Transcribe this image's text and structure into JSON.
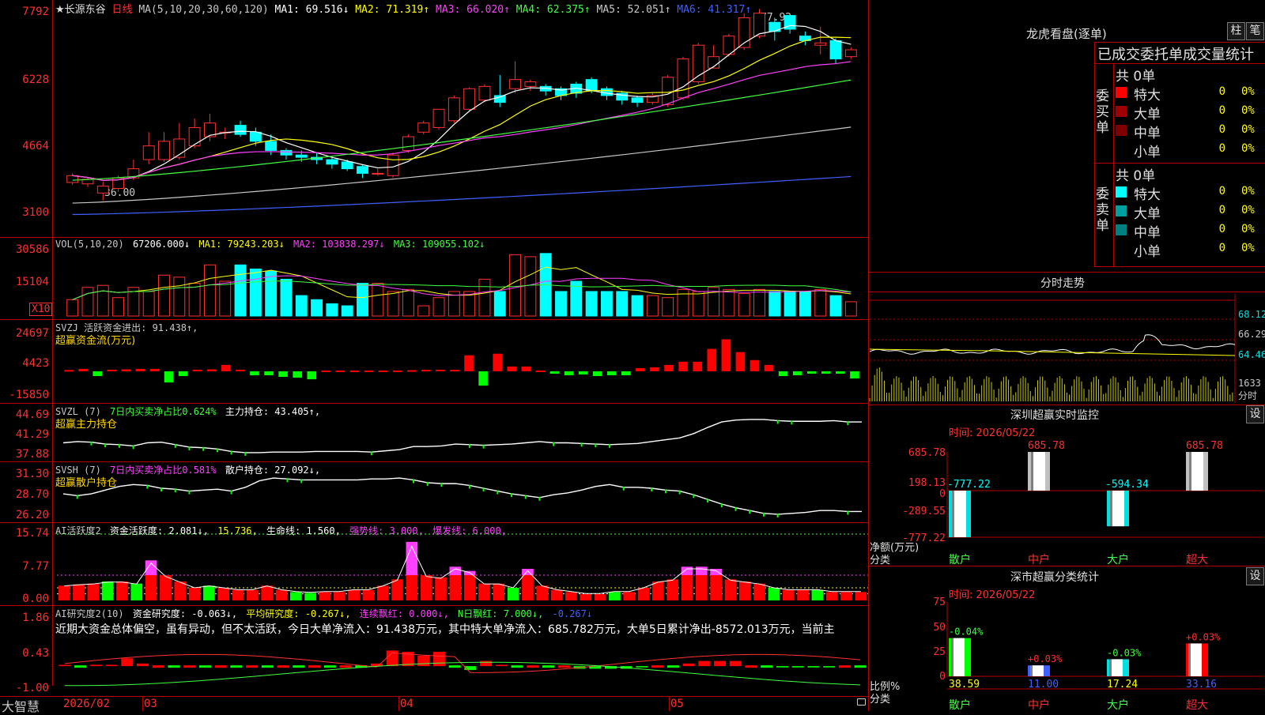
{
  "header": {
    "stock_name": "★长源东谷",
    "period": "日线",
    "ma_params": "MA(5,10,20,30,60,120)",
    "ma_items": [
      {
        "label": "MA1: 69.516↓",
        "color": "#ffffff"
      },
      {
        "label": "MA2: 71.319↑",
        "color": "#ffff00"
      },
      {
        "label": "MA3: 66.020↑",
        "color": "#ff40ff"
      },
      {
        "label": "MA4: 62.375↑",
        "color": "#40ff40"
      },
      {
        "label": "MA5: 52.051↑",
        "color": "#c8c8c8"
      },
      {
        "label": "MA6: 41.317↑",
        "color": "#4060ff"
      }
    ],
    "high_marker": "77.92",
    "low_marker": "36.00"
  },
  "panels": {
    "vol": {
      "params": "VOL(5,10,20)",
      "items": [
        {
          "label": "67206.000↓",
          "color": "#ffffff"
        },
        {
          "label": "MA1: 79243.203↓",
          "color": "#ffff00"
        },
        {
          "label": "MA2: 103838.297↓",
          "color": "#ff40ff"
        },
        {
          "label": "MA3: 109055.102↓",
          "color": "#40ff40"
        }
      ],
      "ylabels": [
        "30586",
        "15104"
      ],
      "unit": "X10"
    },
    "svzj": {
      "title": "SVZJ  活跃资金进出: 91.438↑,",
      "sub": "超赢资金流(万元)",
      "ylabels": [
        "24697",
        "4423",
        "-15850"
      ]
    },
    "svzl": {
      "title_a": "SVZL (7)",
      "title_b": "7日内买卖净占比0.624%",
      "title_c": "主力持仓: 43.405↑,",
      "sub": "超赢主力持仓",
      "ylabels": [
        "44.69",
        "41.29",
        "37.88"
      ]
    },
    "svsh": {
      "title_a": "SVSH (7)",
      "title_b": "7日内买卖净占比0.581%",
      "title_c": "散户持仓: 27.092↓,",
      "sub": "超赢散户持仓",
      "ylabels": [
        "31.30",
        "28.70",
        "26.20"
      ]
    },
    "ai1": {
      "items": [
        {
          "label": "AI活跃度2",
          "color": "#c8c8c8"
        },
        {
          "label": "资金活跃度: 2.081↓,",
          "color": "#ffffff"
        },
        {
          "label": "15.736,",
          "color": "#ffff00"
        },
        {
          "label": "生命线: 1.560,",
          "color": "#ffffff"
        },
        {
          "label": "强势线: 3.000,",
          "color": "#ff40ff"
        },
        {
          "label": "爆发线: 6.000,",
          "color": "#ff40ff"
        }
      ],
      "ylabels": [
        "15.74",
        "7.77",
        "0.00"
      ]
    },
    "ai2": {
      "items": [
        {
          "label": "AI研究度2(10)",
          "color": "#c8c8c8"
        },
        {
          "label": "资金研究度: -0.063↓,",
          "color": "#ffffff"
        },
        {
          "label": "平均研究度: -0.267↓,",
          "color": "#ffff00"
        },
        {
          "label": "连续飘红: 0.000↓,",
          "color": "#ff40ff"
        },
        {
          "label": "N日飘红: 7.000↓,",
          "color": "#40ff40"
        },
        {
          "label": "-0.267↓",
          "color": "#4060ff"
        }
      ],
      "text": "近期大资金总体偏空，虽有异动，但不太活跃，今日大单净流入：91.438万元，其中特大单净流入：685.782万元，大单5日累计净出-8572.013万元，当前主",
      "ylabels": [
        "1.86",
        "0.43",
        "-1.00"
      ]
    }
  },
  "price_axis": [
    "7792",
    "6228",
    "4664",
    "3100"
  ],
  "xaxis": {
    "brand": "大智慧",
    "dates": [
      "2026/02",
      "03",
      "04",
      "05"
    ]
  },
  "right": {
    "dragon_title": "龙虎看盘(逐单)",
    "btn_bar": "柱",
    "btn_pen": "笔",
    "stats_header": "已成交委托单成交量统计",
    "buy_label": "委买单",
    "sell_label": "委卖单",
    "buy_total": "共 0单",
    "sell_total": "共 0单",
    "buy_rows": [
      {
        "name": "特大",
        "value": "0",
        "pct": "0%",
        "color": "#ff0000"
      },
      {
        "name": "大单",
        "value": "0",
        "pct": "0%",
        "color": "#a00000"
      },
      {
        "name": "中单",
        "value": "0",
        "pct": "0%",
        "color": "#800000"
      },
      {
        "name": "小单",
        "value": "0",
        "pct": "0%",
        "color": ""
      }
    ],
    "sell_rows": [
      {
        "name": "特大",
        "value": "0",
        "pct": "0%",
        "color": "#00ffff"
      },
      {
        "name": "大单",
        "value": "0",
        "pct": "0%",
        "color": "#00a0a0"
      },
      {
        "name": "中单",
        "value": "0",
        "pct": "0%",
        "color": "#008080"
      },
      {
        "name": "小单",
        "value": "0",
        "pct": "0%",
        "color": ""
      }
    ],
    "intraday_title": "分时走势",
    "intraday_ylabels": [
      "68.12",
      "66.29",
      "64.46"
    ],
    "intraday_vol_label": "1633",
    "intraday_unit": "分时",
    "monitor_title": "深圳超赢实时监控",
    "monitor_btn": "设",
    "monitor_time": "时间: 2026/05/22",
    "monitor_ylabels": [
      "685.78",
      "198.13",
      "0",
      "-289.55",
      "-777.22"
    ],
    "monitor_axis_label": "净额(万元)",
    "monitor_axis_sub": "分类",
    "classify_title": "深市超赢分类统计",
    "classify_btn": "设",
    "classify_time": "时间: 2026/05/22",
    "classify_ylabels": [
      "75",
      "50",
      "25",
      "0"
    ],
    "classify_axis_label": "比例%",
    "classify_axis_sub": "分类",
    "categories": [
      "散户",
      "中户",
      "大户",
      "超大"
    ]
  },
  "chart_data": [
    {
      "type": "candlestick",
      "title": "长源东谷 日线",
      "ylim": [
        30.5,
        78.5
      ],
      "x": [
        "2026/02",
        "",
        "",
        "",
        "03",
        "",
        "",
        "",
        "",
        "",
        "",
        "",
        "",
        "",
        "",
        "",
        "",
        "",
        "",
        "",
        "04",
        "",
        "",
        "",
        "",
        "",
        "",
        "",
        "",
        "",
        "",
        "",
        "",
        "",
        "",
        "",
        "",
        "",
        "",
        "",
        "05",
        "",
        "",
        "",
        "",
        "",
        "",
        "",
        "",
        "",
        "",
        ""
      ],
      "open": [
        40.0,
        39.7,
        37.7,
        38.7,
        41.0,
        45.0,
        45.0,
        45.5,
        48.0,
        50.0,
        51.0,
        52.5,
        51.0,
        49.0,
        47.0,
        46.0,
        45.5,
        45.0,
        44.5,
        43.5,
        42.0,
        41.5,
        47.0,
        51.0,
        52.0,
        53.5,
        56.0,
        58.0,
        59.0,
        60.5,
        61.0,
        61.0,
        60.5,
        61.5,
        62.5,
        60.5,
        59.5,
        58.5,
        57.5,
        57.0,
        58.5,
        62.0,
        65.0,
        68.0,
        69.5,
        72.0,
        75.0,
        76.5,
        72.0,
        70.0,
        71.0,
        67.5
      ],
      "close": [
        41.5,
        40.7,
        39.2,
        41.0,
        43.0,
        48.0,
        49.0,
        49.5,
        52.0,
        53.0,
        51.0,
        50.5,
        49.0,
        47.0,
        46.0,
        45.5,
        45.0,
        44.0,
        43.0,
        42.0,
        42.0,
        46.0,
        50.0,
        53.0,
        56.0,
        58.5,
        60.5,
        61.0,
        57.5,
        62.5,
        62.0,
        60.0,
        59.0,
        59.5,
        60.0,
        59.0,
        58.0,
        57.5,
        59.0,
        63.0,
        67.0,
        70.0,
        67.5,
        72.0,
        76.0,
        77.0,
        73.0,
        73.5,
        71.0,
        70.5,
        67.0,
        69.0
      ],
      "high": [
        42.0,
        41.2,
        40.2,
        41.5,
        45.0,
        51.0,
        51.0,
        53.0,
        54.0,
        55.0,
        52.0,
        53.5,
        52.0,
        50.5,
        47.5,
        47.0,
        46.5,
        45.5,
        45.0,
        44.0,
        43.0,
        46.5,
        50.5,
        53.5,
        56.0,
        59.0,
        60.8,
        61.5,
        63.5,
        66.5,
        62.5,
        61.5,
        61.0,
        62.0,
        63.0,
        61.0,
        60.0,
        59.0,
        59.5,
        63.5,
        67.5,
        70.5,
        70.0,
        72.5,
        77.0,
        77.92,
        76.0,
        76.5,
        73.0,
        74.0,
        71.5,
        69.5
      ],
      "low": [
        39.5,
        39.0,
        36.0,
        38.0,
        40.5,
        44.0,
        44.5,
        45.0,
        47.5,
        49.0,
        49.5,
        50.0,
        48.0,
        46.0,
        45.0,
        44.5,
        44.0,
        43.0,
        42.5,
        41.0,
        41.5,
        41.0,
        46.5,
        50.5,
        51.5,
        53.0,
        55.5,
        57.5,
        56.5,
        59.5,
        60.0,
        59.0,
        58.0,
        58.5,
        59.5,
        58.0,
        57.0,
        56.5,
        57.0,
        56.5,
        58.0,
        61.5,
        65.0,
        67.5,
        69.0,
        71.5,
        71.0,
        72.5,
        70.0,
        68.0,
        66.0,
        67.0
      ]
    },
    {
      "type": "bar",
      "title": "VOL(5,10,20)",
      "ylim": [
        0,
        34000
      ],
      "values": [
        8000,
        14000,
        15000,
        9000,
        14000,
        12000,
        20000,
        19000,
        16000,
        25000,
        17000,
        25000,
        23000,
        22000,
        18000,
        10000,
        8000,
        6000,
        5000,
        16000,
        16000,
        12000,
        13000,
        5000,
        9000,
        12000,
        12000,
        18000,
        12000,
        30000,
        29000,
        30586,
        12000,
        17000,
        12000,
        12000,
        12000,
        10000,
        10000,
        9000,
        13000,
        12000,
        14000,
        13000,
        11000,
        13000,
        12000,
        12000,
        12000,
        13000,
        10000,
        7000
      ]
    },
    {
      "type": "bar",
      "title": "超赢资金流(万元)",
      "ylim": [
        -15850,
        24697
      ],
      "values": [
        800,
        1500,
        -3000,
        1000,
        1200,
        1500,
        1500,
        -7000,
        -3000,
        1000,
        1200,
        4000,
        1000,
        -2500,
        -2500,
        -3500,
        -4000,
        -5000,
        500,
        500,
        500,
        500,
        500,
        500,
        700,
        900,
        1000,
        900,
        10000,
        -9000,
        11000,
        3000,
        3000,
        500,
        -1500,
        -2500,
        -2000,
        -3000,
        -2500,
        -2500,
        2000,
        2500,
        4000,
        6000,
        6000,
        14000,
        20000,
        12000,
        7000,
        4000,
        -3000,
        -2500,
        -1500,
        -1500,
        -1500,
        -4500
      ]
    },
    {
      "type": "line",
      "title": "超赢主力持仓",
      "ylim": [
        37.88,
        44.69
      ],
      "values": [
        40.0,
        40.2,
        40.1,
        39.8,
        39.7,
        39.5,
        40.0,
        40.1,
        39.7,
        39.3,
        39.2,
        39.0,
        38.6,
        38.4,
        38.4,
        38.5,
        38.5,
        38.5,
        38.6,
        38.6,
        38.6,
        38.6,
        38.5,
        38.7,
        38.9,
        39.4,
        39.4,
        39.5,
        39.8,
        39.7,
        39.6,
        39.7,
        39.8,
        40.0,
        40.2,
        40.0,
        40.0,
        39.9,
        39.8,
        39.7,
        39.8,
        39.9,
        40.2,
        40.5,
        40.8,
        41.5,
        42.5,
        43.4,
        43.7,
        43.8,
        43.8,
        43.6,
        43.5,
        43.5,
        43.5,
        43.6,
        43.4,
        43.4
      ]
    },
    {
      "type": "line",
      "title": "超赢散户持仓",
      "ylim": [
        26.2,
        31.3
      ],
      "values": [
        29.0,
        28.8,
        29.0,
        29.4,
        29.8,
        30.0,
        29.9,
        29.6,
        29.5,
        29.3,
        29.4,
        29.5,
        29.3,
        29.7,
        30.4,
        30.7,
        30.6,
        30.5,
        30.5,
        30.5,
        30.5,
        30.5,
        30.6,
        30.6,
        30.7,
        30.5,
        30.2,
        30.1,
        30.1,
        29.9,
        29.6,
        29.3,
        29.0,
        28.8,
        28.6,
        28.9,
        29.1,
        29.4,
        29.8,
        30.0,
        29.7,
        29.7,
        29.6,
        29.4,
        29.3,
        28.9,
        28.4,
        27.9,
        27.5,
        27.2,
        26.9,
        26.8,
        26.9,
        27.0,
        27.2,
        27.2,
        27.1,
        27.1
      ]
    },
    {
      "type": "bar",
      "title": "AI活跃度2",
      "ylim": [
        0,
        15.74
      ],
      "values": [
        3.5,
        3.8,
        4.0,
        4.5,
        4.5,
        4.0,
        9.5,
        6.0,
        4.5,
        3.0,
        3.5,
        3.0,
        2.5,
        2.5,
        3.5,
        2.5,
        2.0,
        1.8,
        2.0,
        2.0,
        2.5,
        2.5,
        3.5,
        5.0,
        13.9,
        6.0,
        5.5,
        8.0,
        7.0,
        4.0,
        4.0,
        3.0,
        7.5,
        3.5,
        2.5,
        2.0,
        1.5,
        1.5,
        2.0,
        2.0,
        3.0,
        4.5,
        5.0,
        8.0,
        8.0,
        7.5,
        5.0,
        4.5,
        4.0,
        3.0,
        2.5,
        2.5,
        2.5,
        2.0,
        2.0,
        2.0
      ],
      "lines": {
        "生命线": 1.56,
        "强势线": 3.0,
        "爆发线": 6.0,
        "upper": 15.736
      }
    },
    {
      "type": "bar",
      "title": "AI研究度2(10)",
      "ylim": [
        -1.0,
        1.86
      ],
      "values": [
        0.05,
        0.0,
        0.05,
        0.05,
        0.3,
        0.1,
        0.0,
        0.0,
        0.0,
        0.0,
        0.0,
        0.0,
        0.0,
        0.0,
        0.0,
        0.0,
        0.0,
        0.0,
        0.0,
        0.0,
        0.1,
        0.6,
        0.55,
        0.4,
        0.55,
        0.0,
        -0.15,
        0.2,
        0.05,
        0.0,
        0.0,
        0.0,
        0.0,
        -0.1,
        -0.1,
        -0.1,
        -0.1,
        -0.05,
        0.0,
        0.0,
        0.1,
        0.2,
        0.2,
        0.2,
        0.0,
        0.0,
        -0.05,
        -0.05,
        -0.05,
        -0.05,
        0.0,
        0.0
      ]
    },
    {
      "type": "bar",
      "title": "深圳超赢实时监控",
      "categories": [
        "散户",
        "中户",
        "大户",
        "超大"
      ],
      "values": [
        -777.22,
        685.78,
        -594.34,
        685.78
      ],
      "ylim": [
        -777.22,
        685.78
      ]
    },
    {
      "type": "bar",
      "title": "深市超赢分类统计",
      "categories": [
        "散户",
        "中户",
        "大户",
        "超大"
      ],
      "values": [
        38.59,
        11.0,
        17.24,
        33.16
      ],
      "changes": [
        "-0.04%",
        "+0.03%",
        "-0.03%",
        "+0.03%"
      ],
      "ylim": [
        0,
        75
      ]
    }
  ]
}
